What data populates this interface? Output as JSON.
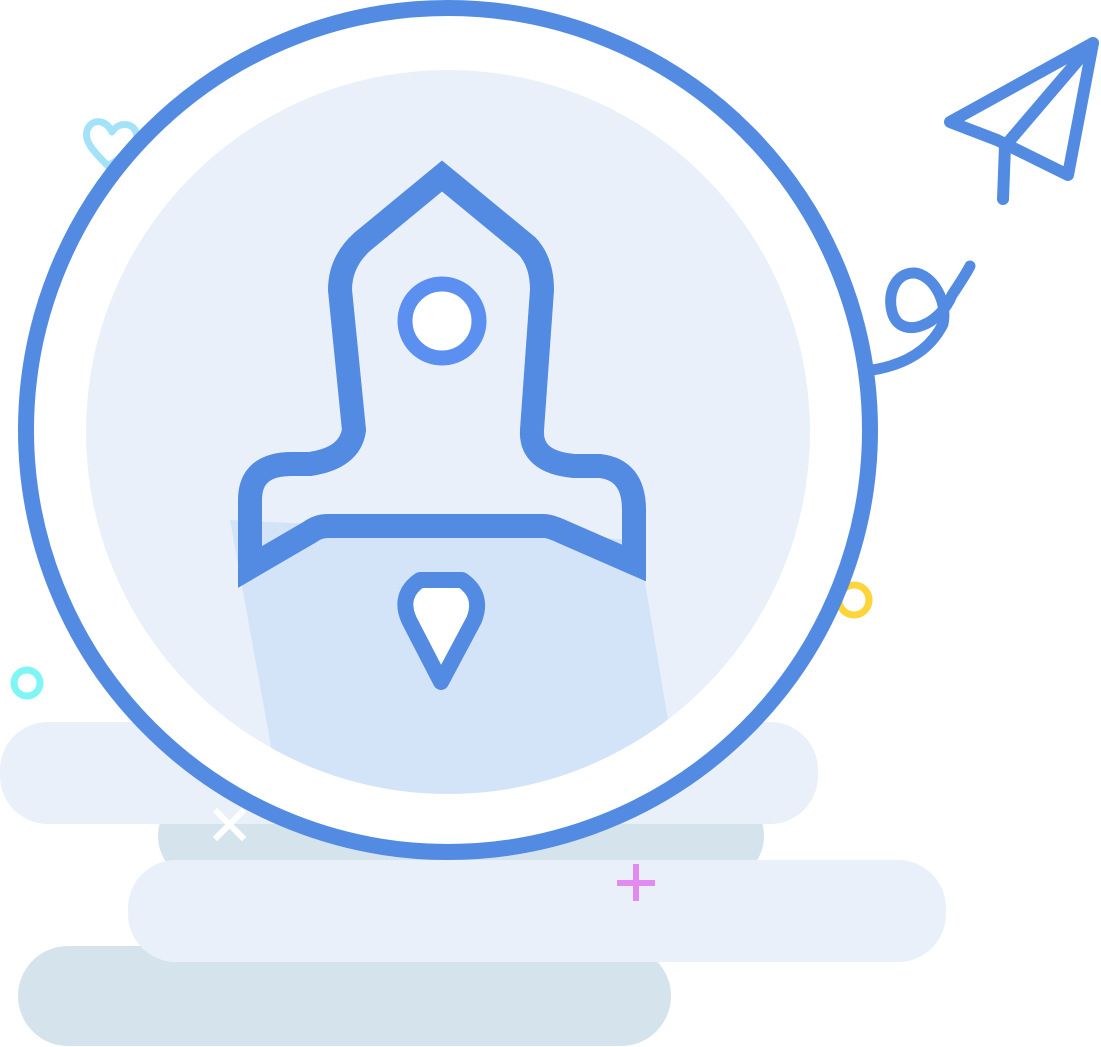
{
  "illustration": {
    "subject": "rocket",
    "icons": [
      "rocket-icon",
      "paper-plane-icon",
      "heart-icon",
      "loop-doodle-icon",
      "ring-icon",
      "plus-icon",
      "cross-icon"
    ],
    "colors": {
      "primary_stroke": "#528be1",
      "porthole_stroke": "#5b8ff0",
      "circle_fill": "#e9f0fa",
      "circle_ring_fill": "#ffffff",
      "flame_fill": "#d3e4f9",
      "cloud_light": "#e9f0fa",
      "cloud_dark": "#d5e3ec",
      "heart": "#a4e2f8",
      "ring_cyan": "#7ff6f5",
      "ring_yellow": "#fdd43a",
      "plus_pink": "#e18af1",
      "cross_white": "#ffffff"
    }
  }
}
